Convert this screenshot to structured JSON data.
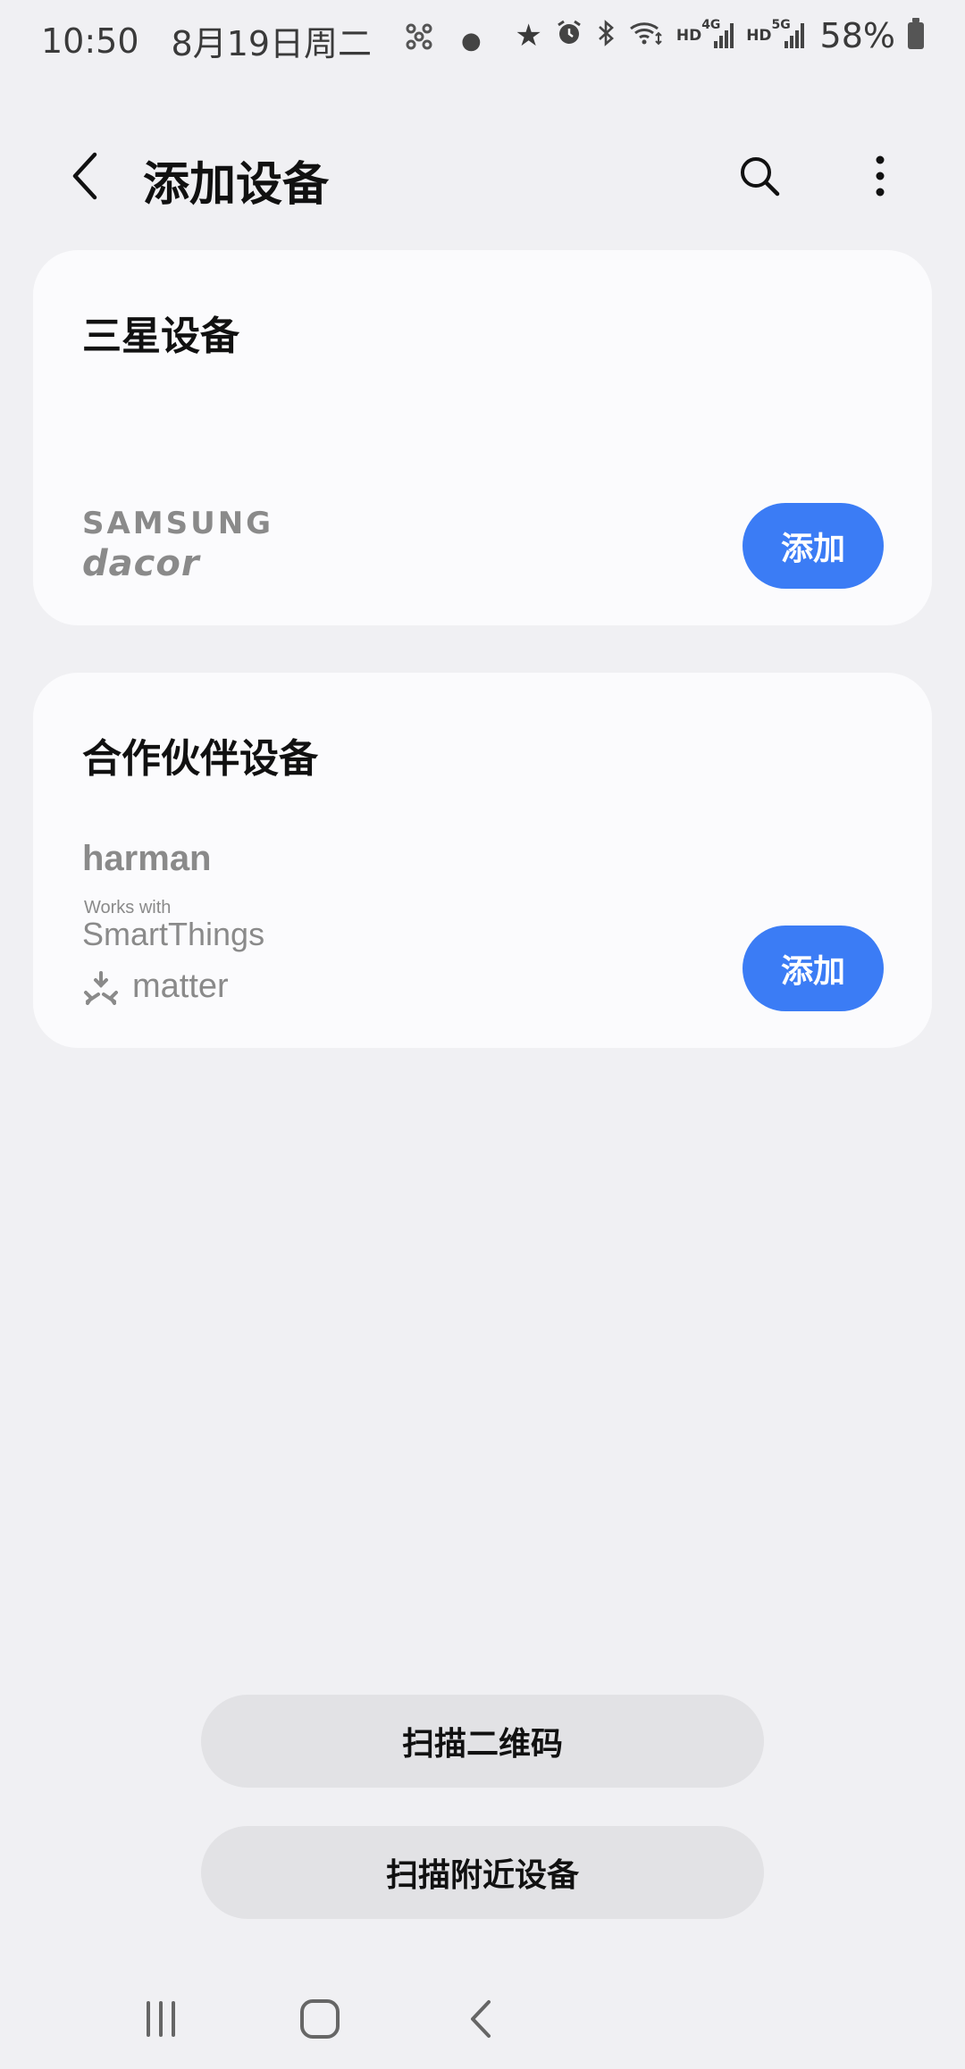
{
  "status_bar": {
    "time": "10:50",
    "date": "8月19日周二",
    "notification_icons": [
      "fan-icon",
      "dot-icon"
    ],
    "system_icons": [
      "star-icon",
      "alarm-icon",
      "bluetooth-icon",
      "wifi-icon",
      "hd-icon",
      "signal-4g-icon",
      "hd-icon",
      "signal-5g-icon"
    ],
    "hd_label": "HD",
    "net_4g": "4G",
    "net_5g": "5G",
    "battery": "58%"
  },
  "header": {
    "title": "添加设备",
    "back_icon": "chevron-left-icon",
    "search_icon": "search-icon",
    "more_icon": "more-vertical-icon"
  },
  "cards": [
    {
      "title": "三星设备",
      "brands": [
        "SAMSUNG",
        "dacor"
      ],
      "add_label": "添加"
    },
    {
      "title": "合作伙伴设备",
      "brands": [
        "harman",
        "Works with",
        "SmartThings",
        "matter"
      ],
      "add_label": "添加"
    }
  ],
  "actions": {
    "scan_qr": "扫描二维码",
    "scan_nearby": "扫描附近设备"
  },
  "nav_bar": {
    "icons": [
      "recent-apps-icon",
      "home-icon",
      "back-icon"
    ]
  },
  "colors": {
    "accent": "#3b7cf5",
    "background": "#f0f0f3",
    "card": "#fbfbfd",
    "secondary_button": "#e2e2e5"
  }
}
